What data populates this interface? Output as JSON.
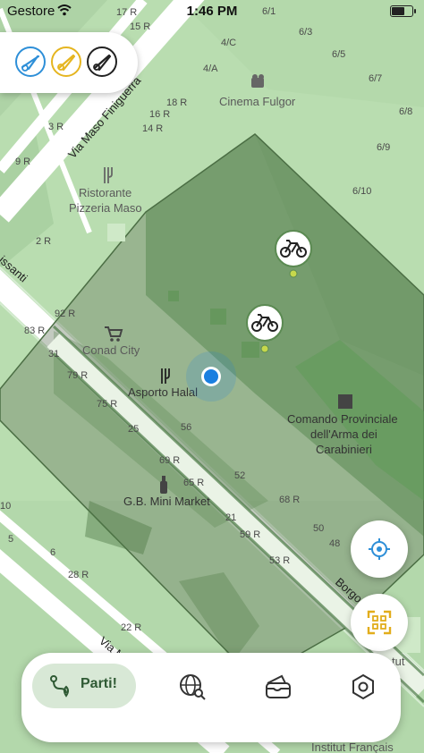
{
  "status_bar": {
    "carrier": "Gestore",
    "time": "1:46 PM"
  },
  "map": {
    "poi": {
      "cinema": "Cinema Fulgor",
      "ristorante_1": "Ristorante",
      "ristorante_2": "Pizzeria Maso",
      "conad": "Conad City",
      "asporto": "Asporto Halal",
      "comando_1": "Comando Provinciale",
      "comando_2": "dell'Arma dei",
      "comando_3": "Carabinieri",
      "minimarket": "G.B. Mini Market",
      "institut_partial": "Institut Français",
      "tut_partial": "tut"
    },
    "streets": {
      "finiguerra": "Via Maso Finiguerra",
      "ognissanti": "issanti",
      "borgo": "Borgo",
      "borgo_end": "anti",
      "montebello": "Via Monte"
    },
    "house_numbers": {
      "n1": "17 R",
      "n2": "6/1",
      "n3": "15 R",
      "n4": "6/3",
      "n5": "4/C",
      "n6": "6/5",
      "n7": "4/A",
      "n8": "6/7",
      "n9": "5 R",
      "n10": "18 R",
      "n11": "6/8",
      "n12": "16 R",
      "n13": "3 R",
      "n14": "14 R",
      "n15": "6/9",
      "n16": "9 R",
      "n17": "6/10",
      "n18": "2 R",
      "n19": "92 R",
      "n20": "83 R",
      "n21": "31",
      "n22": "79 R",
      "n23": "75 R",
      "n24": "25",
      "n25": "56",
      "n26": "69 R",
      "n27": "65 R",
      "n28": "52",
      "n29": "68 R",
      "n30": "21",
      "n31": "50",
      "n32": "59 R",
      "n33": "48",
      "n34": "53 R",
      "n35": "10",
      "n36": "6",
      "n37": "28 R",
      "n38": "22 R",
      "n39": "5"
    }
  },
  "bottom_nav": {
    "start_label": "Parti!"
  },
  "icons": {
    "mode_1": "walk-bike-icon",
    "mode_2": "bike-icon",
    "mode_3": "scooter-icon",
    "bike_station": "bike-icon",
    "locate": "locate-icon",
    "scan": "qr-scan-icon",
    "route": "route-icon",
    "explore": "globe-search-icon",
    "wallet": "wallet-icon",
    "settings": "settings-icon"
  },
  "colors": {
    "accent": "#2f5a34",
    "user_location": "#1a7fe0",
    "mode_blue": "#2e8fd8",
    "mode_yellow": "#e5b520",
    "mode_black": "#222222",
    "scan_yellow": "#e2ad1c"
  }
}
